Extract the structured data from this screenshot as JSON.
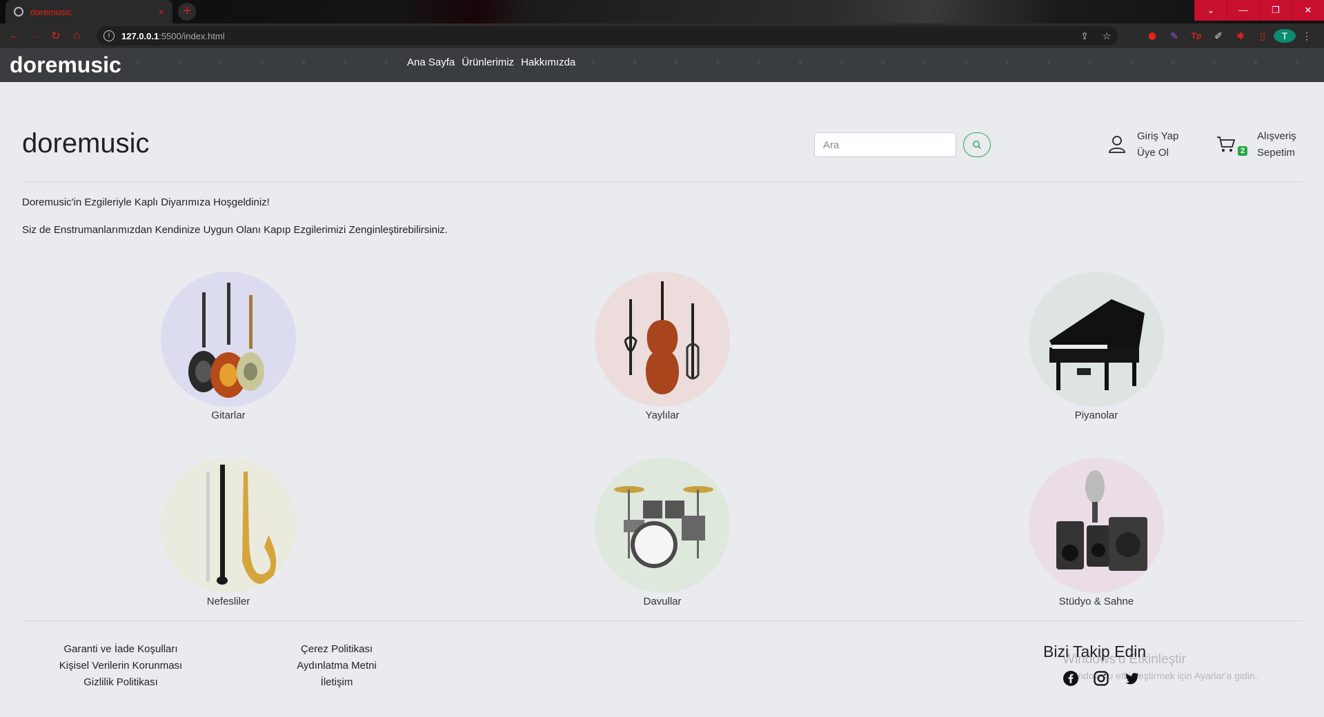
{
  "browser": {
    "tab_title": "doremusic",
    "tab_close": "×",
    "new_tab": "+",
    "url_host": "127.0.0.1",
    "url_path": ":5500/index.html",
    "window_controls": [
      "⌄",
      "—",
      "❐",
      "✕"
    ],
    "profile_initial": "T"
  },
  "site": {
    "logo": "doremusic",
    "nav": [
      "Ana Sayfa",
      "Ürünlerimiz",
      "Hakkımızda"
    ]
  },
  "header": {
    "brand": "doremusic",
    "search_placeholder": "Ara",
    "login": "Giriş Yap",
    "signup": "Üye Ol",
    "cart_line1": "Alışveriş",
    "cart_line2": "Sepetim",
    "cart_count": "2"
  },
  "intro": {
    "line1": "Doremusic'in Ezgileriyle Kaplı Diyarımıza Hoşgeldiniz!",
    "line2": "Siz de Enstrumanlarımızdan Kendinize Uygun Olanı Kapıp Ezgilerimizi Zenginleştirebilirsiniz."
  },
  "categories": [
    {
      "label": "Gitarlar",
      "bg": "#dcdcf0"
    },
    {
      "label": "Yaylılar",
      "bg": "#ecdcdc"
    },
    {
      "label": "Piyanolar",
      "bg": "#dde4e2"
    },
    {
      "label": "Nefesliler",
      "bg": "#ebeade"
    },
    {
      "label": "Davullar",
      "bg": "#dfe8dc"
    },
    {
      "label": "Stüdyo & Sahne",
      "bg": "#ebdde8"
    }
  ],
  "footer": {
    "col1": [
      "Garanti ve İade Koşulları",
      "Kişisel Verilerin Korunması",
      "Gizlilik Politikası"
    ],
    "col2": [
      "Çerez Politikası",
      "Aydınlatma Metni",
      "İletişim"
    ],
    "follow_title": "Bizi Takip Edin",
    "social_icons": [
      "facebook-icon",
      "instagram-icon",
      "twitter-icon"
    ]
  },
  "overlay": {
    "activate_title": "Windows'u Etkinleştir",
    "activate_text": "Windows'u etkinleştirmek için Ayarlar'a gidin."
  }
}
